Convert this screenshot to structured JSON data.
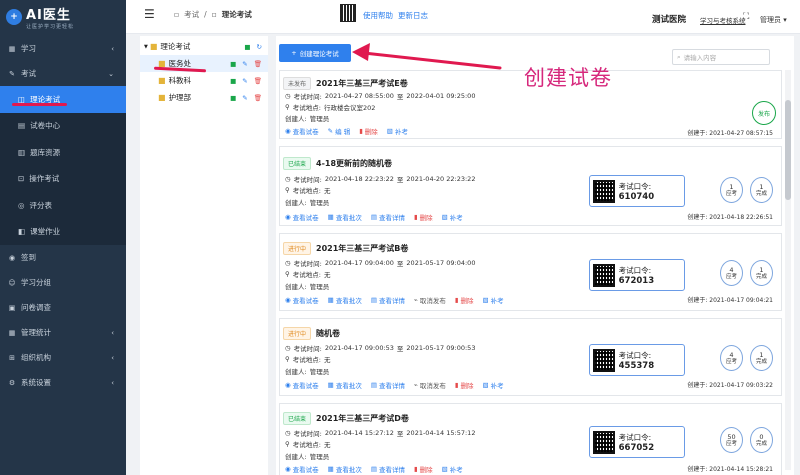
{
  "logo": {
    "mark": "+",
    "title": "AI医生",
    "subtitle": "让医护学习更轻松"
  },
  "sidebar": {
    "items": [
      {
        "icon": "▦",
        "label": "学习",
        "chevron": "‹"
      },
      {
        "icon": "✎",
        "label": "考试",
        "chevron": "⌄"
      }
    ],
    "exam_sub": [
      {
        "icon": "◫",
        "label": "理论考试"
      },
      {
        "icon": "▤",
        "label": "试卷中心"
      },
      {
        "icon": "▥",
        "label": "题库资源"
      },
      {
        "icon": "⊡",
        "label": "操作考试"
      },
      {
        "icon": "◎",
        "label": "评分表"
      },
      {
        "icon": "◧",
        "label": "课堂作业"
      }
    ],
    "items2": [
      {
        "icon": "◉",
        "label": "签到",
        "chevron": ""
      },
      {
        "icon": "☺",
        "label": "学习分组",
        "chevron": ""
      },
      {
        "icon": "▣",
        "label": "问卷调查",
        "chevron": ""
      },
      {
        "icon": "▦",
        "label": "管理统计",
        "chevron": "‹"
      },
      {
        "icon": "⊞",
        "label": "组织机构",
        "chevron": "‹"
      },
      {
        "icon": "⚙",
        "label": "系统设置",
        "chevron": "‹"
      }
    ]
  },
  "topbar": {
    "breadcrumb": [
      "考试",
      "理论考试"
    ],
    "help": "使用帮助",
    "changelog": "更新日志",
    "hospital": "测试医院",
    "hospital_sub": "学习与考核系统",
    "user": "管理员"
  },
  "tree": {
    "root": "理论考试",
    "children": [
      "医务处",
      "科教科",
      "护理部"
    ]
  },
  "main": {
    "create_label": "创建理论考试",
    "search_placeholder": "请输入内容"
  },
  "labels": {
    "time_prefix": "考试时间:",
    "to": "至",
    "place_prefix": "考试地点:",
    "creator_prefix": "创建人:",
    "created_prefix": "创建于:",
    "code_prefix": "考试口令:",
    "should": "应考",
    "done": "完成",
    "publish": "发布"
  },
  "exams": [
    {
      "status": "未发布",
      "title": "2021年三基三严考试E卷",
      "time_start": "2021-04-27 08:55:00",
      "time_end": "2022-04-01 09:25:00",
      "place": "行政楼会议室202",
      "creator": "管理员",
      "created": "2021-04-27 08:57:15",
      "actions": [
        "查看试卷",
        "编 辑",
        "删除",
        "补考"
      ]
    },
    {
      "status": "已结束",
      "title": "4-18更新前的随机卷",
      "time_start": "2021-04-18 22:23:22",
      "time_end": "2021-04-20 22:23:22",
      "place": "无",
      "creator": "管理员",
      "code": "610740",
      "should": "1",
      "done": "1",
      "created": "2021-04-18 22:26:51",
      "actions": [
        "查看试卷",
        "查看批次",
        "查看详情",
        "删除",
        "补考"
      ]
    },
    {
      "status": "进行中",
      "title": "2021年三基三严考试B卷",
      "time_start": "2021-04-17 09:04:00",
      "time_end": "2021-05-17 09:04:00",
      "place": "无",
      "creator": "管理员",
      "code": "672013",
      "should": "4",
      "done": "1",
      "created": "2021-04-17 09:04:21",
      "actions": [
        "查看试卷",
        "查看批次",
        "查看详情",
        "取消发布",
        "删除",
        "补考"
      ]
    },
    {
      "status": "进行中",
      "title": "随机卷",
      "time_start": "2021-04-17 09:00:53",
      "time_end": "2021-05-17 09:00:53",
      "place": "无",
      "creator": "管理员",
      "code": "455378",
      "should": "4",
      "done": "1",
      "created": "2021-04-17 09:03:22",
      "actions": [
        "查看试卷",
        "查看批次",
        "查看详情",
        "取消发布",
        "删除",
        "补考"
      ]
    },
    {
      "status": "已结束",
      "title": "2021年三基三严考试D卷",
      "time_start": "2021-04-14 15:27:12",
      "time_end": "2021-04-14 15:57:12",
      "place": "无",
      "creator": "管理员",
      "code": "667052",
      "should": "50",
      "done": "0",
      "created": "2021-04-14 15:28:21",
      "actions": [
        "查看试卷",
        "查看批次",
        "查看详情",
        "删除",
        "补考"
      ]
    }
  ],
  "annotation": {
    "text": "创建试卷"
  },
  "colors": {
    "primary": "#2f80ed",
    "sidebar": "#243548",
    "annotation": "#e0194f"
  }
}
